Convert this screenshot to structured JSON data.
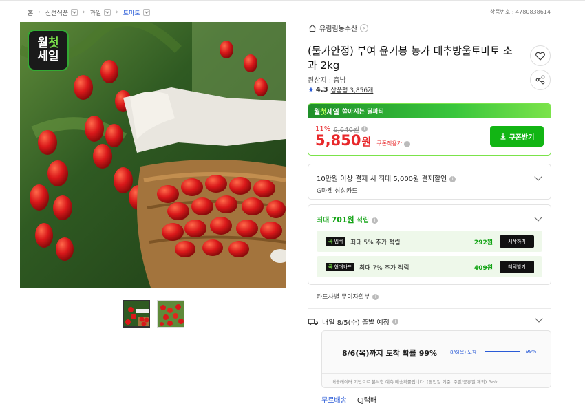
{
  "breadcrumb": {
    "items": [
      {
        "label": "홈",
        "dropdown": false
      },
      {
        "label": "신선식품",
        "dropdown": true
      },
      {
        "label": "과일",
        "dropdown": true
      },
      {
        "label": "토마토",
        "dropdown": true
      }
    ]
  },
  "product_no": "상품번호 : 4780838614",
  "image": {
    "badge_line1_a": "월",
    "badge_line1_b": "첫",
    "badge_line2": "세일",
    "thumbnail_count": 2,
    "selected_thumbnail": 0
  },
  "seller": {
    "name": "유림림농수산"
  },
  "product": {
    "title": "(물가안정) 부여 윤기봉 농가 대추방울토마토 소과 2kg",
    "origin": "원산지 : 충남",
    "rating": "4.3",
    "reviews_label": "상품평 3,856개"
  },
  "sale": {
    "brand_a": "월",
    "brand_b": "첫",
    "brand_c": "세일",
    "tagline": "쏟아지는 딜파티",
    "discount_pct": "11%",
    "original_price": "6,640원",
    "price": "5,850",
    "price_unit": "원",
    "coupon_label": "쿠폰적용가",
    "coupon_button": "쿠폰받기"
  },
  "card_promo": {
    "title": "10만원 이상 결제 시 최대 5,000원 결제할인",
    "subtitle": "G마켓 삼성카드"
  },
  "points": {
    "title_prefix": "최대 ",
    "title_amount": "701원",
    "title_suffix": " 적립",
    "rows": [
      {
        "tag_a": "곡",
        "tag_b": "멤버",
        "desc": "최대 5% 추가 적립",
        "amount": "292원",
        "button": "시작하기"
      },
      {
        "tag_a": "곡",
        "tag_b": "현대카드",
        "desc": "최대 7% 추가 적립",
        "amount": "409원",
        "button": "혜택받기"
      }
    ]
  },
  "installment": "카드사별 무이자할부",
  "delivery": {
    "label": "내일 8/5(수) 출발 예정",
    "eta_main": "8/6(목)까지 도착 확률 99%",
    "eta_label": "8/6(목) 도착",
    "eta_probability": 0.99,
    "eta_pct": "99%",
    "note": "배송데이터 기반으로 분석한 예측 배송확률입니다. (영업일 기준, 주말/공휴일 제외)",
    "note_beta": "Beta",
    "free_shipping": "무료배송",
    "carrier": "CJ택배"
  },
  "colors": {
    "accent_green": "#12b514",
    "price_red": "#e8282b",
    "link_blue": "#2a5bd7"
  },
  "icons": [
    "home-icon",
    "chevron-right-icon",
    "heart-icon",
    "share-icon",
    "star-icon",
    "download-icon",
    "info-icon",
    "chevron-down-icon",
    "truck-icon"
  ]
}
